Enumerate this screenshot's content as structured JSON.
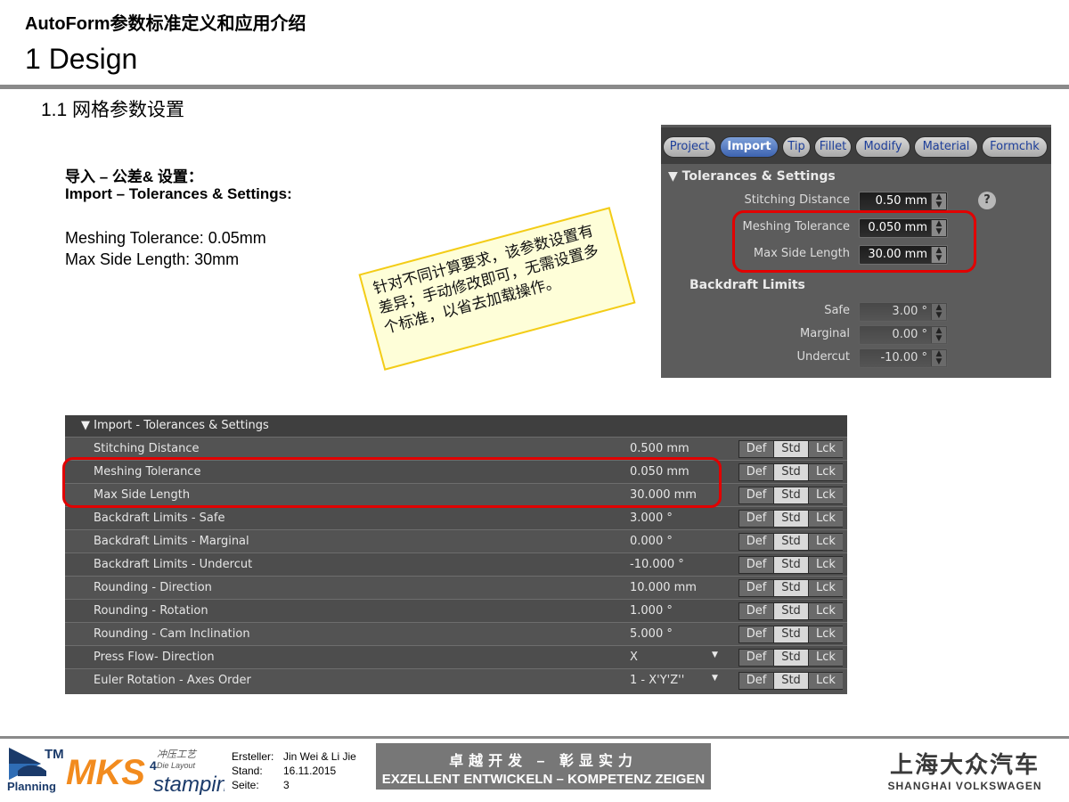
{
  "header": {
    "doc_title": "AutoForm参数标准定义和应用介绍",
    "section_title": "1 Design",
    "subsection_title": "1.1 网格参数设置"
  },
  "left_text": {
    "import_cn": "导入 – 公差& 设置：",
    "import_en": "Import – Tolerances & Settings:",
    "param_1": "Meshing Tolerance: 0.05mm",
    "param_2": "Max Side Length: 30mm"
  },
  "note": {
    "text": "针对不同计算要求，该参数设置有差异；手动修改即可，无需设置多个标准，以省去加载操作。"
  },
  "panel": {
    "tabs": [
      "Project",
      "Import",
      "Tip",
      "Fillet",
      "Modify",
      "Material",
      "Formchk"
    ],
    "active_tab": "Import",
    "section_tolerances": "▼ Tolerances & Settings",
    "section_backdraft": "Backdraft Limits",
    "help": "?",
    "fields": {
      "stitching": {
        "label": "Stitching Distance",
        "value": "0.50 mm"
      },
      "meshing": {
        "label": "Meshing Tolerance",
        "value": "0.050 mm"
      },
      "maxside": {
        "label": "Max Side Length",
        "value": "30.00 mm"
      },
      "safe": {
        "label": "Safe",
        "value": "3.00 °"
      },
      "marginal": {
        "label": "Marginal",
        "value": "0.00 °"
      },
      "undercut": {
        "label": "Undercut",
        "value": "-10.00 °"
      }
    }
  },
  "table": {
    "header": "▼ Import - Tolerances & Settings",
    "buttons": {
      "def": "Def",
      "std": "Std",
      "lck": "Lck"
    },
    "dropdown_glyph": "▼",
    "rows": [
      {
        "label": "Stitching Distance",
        "value": "0.500 mm"
      },
      {
        "label": "Meshing Tolerance",
        "value": "0.050 mm"
      },
      {
        "label": "Max Side Length",
        "value": "30.000 mm"
      },
      {
        "label": "Backdraft Limits - Safe",
        "value": "3.000 °"
      },
      {
        "label": "Backdraft Limits - Marginal",
        "value": "0.000 °"
      },
      {
        "label": "Backdraft Limits - Undercut",
        "value": "-10.000 °"
      },
      {
        "label": "Rounding - Direction",
        "value": "10.000 mm"
      },
      {
        "label": "Rounding - Rotation",
        "value": "1.000 °"
      },
      {
        "label": "Rounding - Cam Inclination",
        "value": "5.000 °"
      },
      {
        "label": "Press Flow- Direction",
        "value": "X"
      },
      {
        "label": "Euler Rotation - Axes Order",
        "value": "1 - X'Y'Z''"
      }
    ]
  },
  "footer": {
    "logo_tm_text": "TM",
    "logo_planning_text": "Planning",
    "logo_mks_text": "MKS",
    "logo_mks_sup": "4",
    "logo_stamping_text": "stamping",
    "logo_cn_text": "冲压工艺",
    "logo_die_text": "Die Layout",
    "ersteller_key": "Ersteller:",
    "ersteller_val": "Jin Wei & Li Jie",
    "stand_key": "Stand:",
    "stand_val": "16.11.2015",
    "seite_key": "Seite:",
    "seite_val": "3",
    "slogan_cn": "卓越开发 – 彰显实力",
    "slogan_de": "EXZELLENT ENTWICKELN – KOMPETENZ ZEIGEN",
    "brand_cn": "上海大众汽车",
    "brand_en": "SHANGHAI VOLKSWAGEN"
  }
}
